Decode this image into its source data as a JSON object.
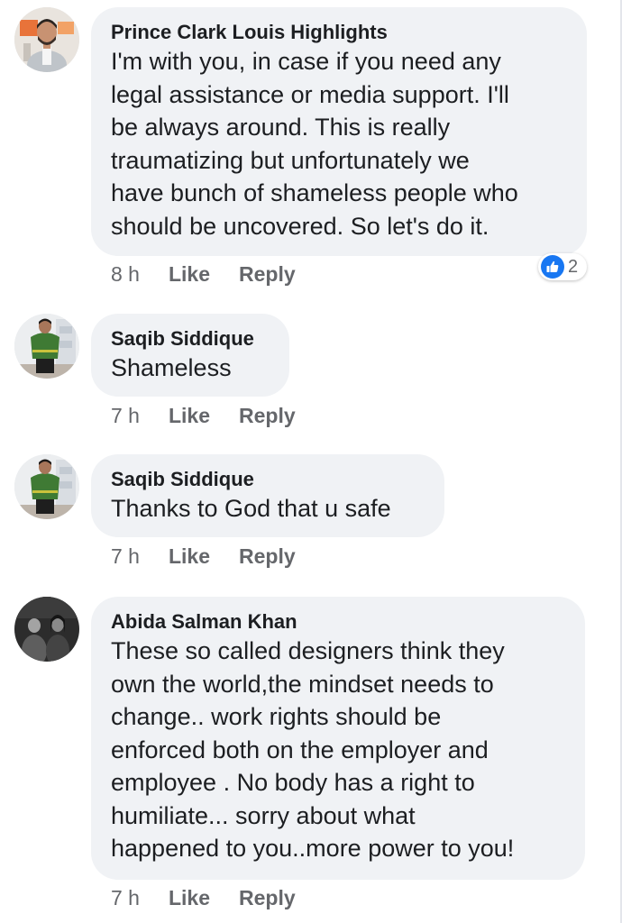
{
  "comments": [
    {
      "author": "Prince Clark Louis Highlights",
      "text": "I'm with you, in case if you need any\nlegal assistance or media support. I'll\nbe always around. This is really\ntraumatizing but unfortunately we\nhave bunch of shameless people who\nshould  be uncovered. So let's do it.",
      "time": "8 h",
      "like_label": "Like",
      "reply_label": "Reply",
      "reaction_count": "2",
      "reaction_icon": "like-icon"
    },
    {
      "author": "Saqib Siddique",
      "text": "Shameless",
      "time": "7 h",
      "like_label": "Like",
      "reply_label": "Reply"
    },
    {
      "author": "Saqib Siddique",
      "text": "Thanks to God that u safe",
      "time": "7 h",
      "like_label": "Like",
      "reply_label": "Reply"
    },
    {
      "author": "Abida Salman Khan",
      "text": "These so called designers think they\nown the world,the mindset needs to\nchange.. work rights should be\nenforced both on the employer and\nemployee . No body has a right to\nhumiliate... sorry about what\nhappened to you..more power to you!",
      "time": "7 h",
      "like_label": "Like",
      "reply_label": "Reply"
    }
  ],
  "colors": {
    "bubble": "#f0f2f5",
    "meta_text": "#65676b",
    "like_blue": "#1877f2"
  }
}
